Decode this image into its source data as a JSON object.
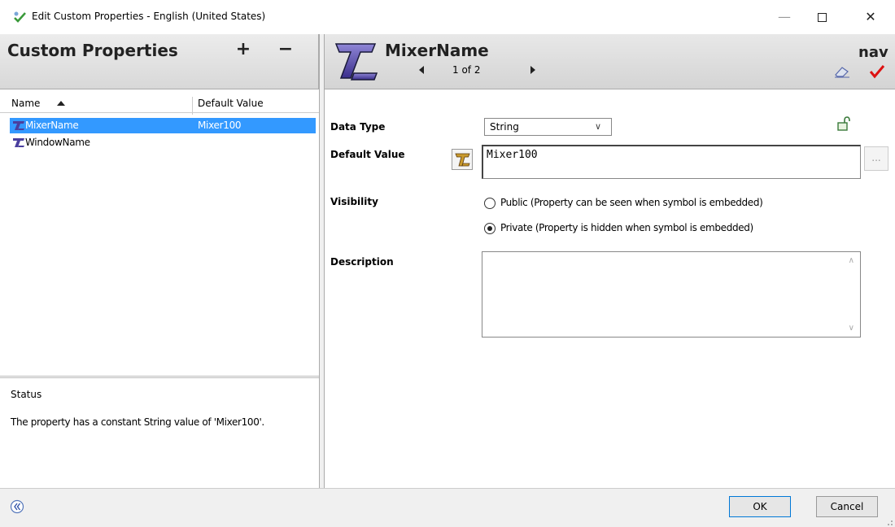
{
  "window": {
    "title": "Edit Custom Properties - English (United States)",
    "minimize": "—",
    "close": "✕"
  },
  "left_header": {
    "title": "Custom Properties",
    "add_label": "+",
    "remove_label": "−"
  },
  "property_list": {
    "columns": [
      "Name",
      "Default Value"
    ],
    "sort": "ascending",
    "rows": [
      {
        "name": "MixerName",
        "value": "Mixer100",
        "selected": true
      },
      {
        "name": "WindowName",
        "value": "",
        "selected": false
      }
    ]
  },
  "status": {
    "label": "Status",
    "text": "The property has a constant String value of 'Mixer100'."
  },
  "right_header": {
    "property_name": "MixerName",
    "page": "1 of 2",
    "nav_text": "nav"
  },
  "form": {
    "data_type_label": "Data Type",
    "data_type_value": "String",
    "default_value_label": "Default Value",
    "default_value": "Mixer100",
    "ellipsis": "...",
    "visibility_label": "Visibility",
    "visibility_options": [
      {
        "label": "Public (Property can be seen when symbol is embedded)",
        "selected": false
      },
      {
        "label": "Private (Property is hidden when symbol is embedded)",
        "selected": true
      }
    ],
    "description_label": "Description",
    "description": ""
  },
  "footer": {
    "ok_label": "OK",
    "cancel_label": "Cancel"
  },
  "colors": {
    "selection": "#3399ff",
    "check": "#dd1111",
    "icon_purple": "#4a3f9e"
  }
}
